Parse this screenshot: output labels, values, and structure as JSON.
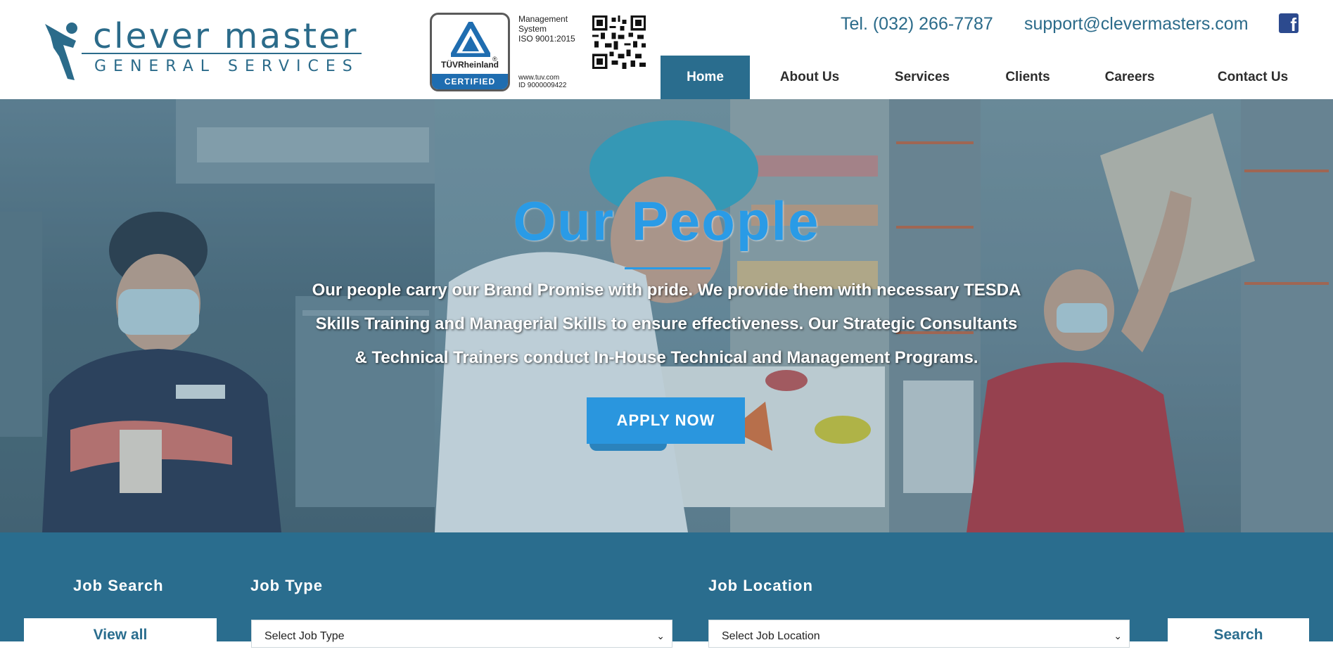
{
  "brand": {
    "name": "clever master",
    "tagline": "GENERAL SERVICES",
    "color": "#2b6b8a"
  },
  "certification": {
    "badge_name": "TÜVRheinland",
    "badge_status": "CERTIFIED",
    "registered_mark": "®",
    "lines": [
      "Management",
      "System",
      "ISO 9001:2015"
    ],
    "url": "www.tuv.com",
    "id": "ID  9000009422"
  },
  "contact": {
    "phone": "Tel. (032) 266-7787",
    "email": "support@clevermasters.com",
    "social_icon": "facebook-icon",
    "social_glyph": "f"
  },
  "nav": {
    "items": [
      {
        "label": "Home",
        "active": true
      },
      {
        "label": "About Us",
        "active": false
      },
      {
        "label": "Services",
        "active": false
      },
      {
        "label": "Clients",
        "active": false
      },
      {
        "label": "Careers",
        "active": false
      },
      {
        "label": "Contact Us",
        "active": false
      }
    ],
    "active_color": "#2a6d8e"
  },
  "hero": {
    "title": "Our People",
    "lines": [
      "Our people carry our Brand Promise with pride. We provide them with necessary TESDA",
      "Skills Training and Managerial Skills to ensure effectiveness. Our Strategic Consultants",
      "& Technical Trainers conduct In-House Technical and Management Programs."
    ],
    "cta": "APPLY NOW",
    "accent": "#2a96de"
  },
  "job_search": {
    "heading": "Job Search",
    "view_all": "View all",
    "type_label": "Job Type",
    "type_selected": "Select Job Type",
    "location_label": "Job Location",
    "location_selected": "Select Job Location",
    "search_button": "Search",
    "background": "#2a6d8e"
  }
}
